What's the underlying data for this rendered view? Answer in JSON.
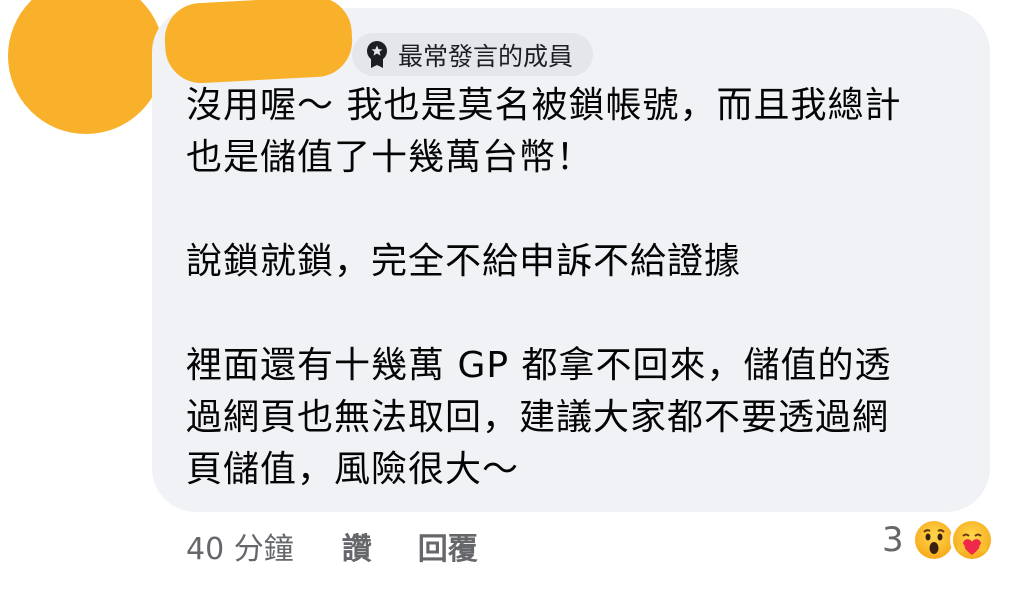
{
  "comment": {
    "badge_label": "最常發言的成員",
    "paragraphs": [
      [
        "沒用喔～ 我也是莫名被鎖帳號，而且我總計",
        "也是儲值了十幾萬台幣！"
      ],
      [
        "說鎖就鎖，完全不給申訴不給證據"
      ],
      [
        "裡面還有十幾萬 GP 都拿不回來，儲值的透",
        "過網頁也無法取回，建議大家都不要透過網",
        "頁儲值，風險很大～"
      ]
    ]
  },
  "actions": {
    "time": "40 分鐘",
    "like_label": "讚",
    "reply_label": "回覆"
  },
  "reactions": {
    "count": "3",
    "icons": [
      "wow-emoji-icon",
      "care-emoji-icon"
    ]
  },
  "colors": {
    "avatar": "#f9b02b",
    "bubble": "#f0f2f5",
    "badge": "#e4e6eb",
    "meta_text": "#65676b"
  }
}
